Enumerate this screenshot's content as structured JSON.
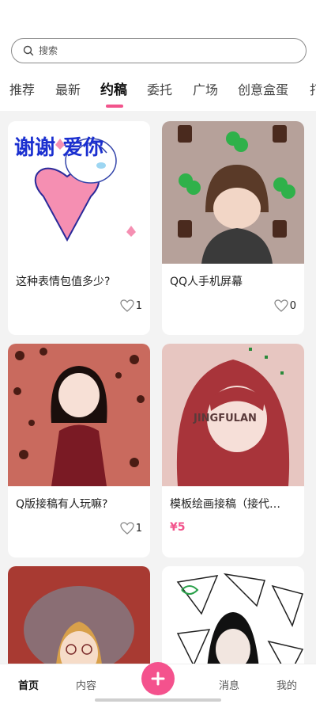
{
  "search": {
    "placeholder": "搜索"
  },
  "tabs": [
    {
      "label": "推荐"
    },
    {
      "label": "最新"
    },
    {
      "label": "约稿"
    },
    {
      "label": "委托"
    },
    {
      "label": "广场"
    },
    {
      "label": "创意盒蛋"
    },
    {
      "label": "打"
    }
  ],
  "active_tab": "约稿",
  "cards": [
    {
      "title": "这种表情包值多少?",
      "likes": "1",
      "image_overlay": "谢谢 爱你"
    },
    {
      "title": "QQ人手机屏幕",
      "likes": "0"
    },
    {
      "title": "Q版接稿有人玩嘛?",
      "likes": "1"
    },
    {
      "title": "模板绘画接稿（接代…",
      "price": "¥5",
      "image_overlay": "JINGFULAN"
    },
    {
      "title": ""
    },
    {
      "title": ""
    }
  ],
  "bottom_nav": {
    "home": "首页",
    "content": "内容",
    "messages": "消息",
    "mine": "我的"
  },
  "colors": {
    "accent": "#f2548c",
    "fab": "#f4528d"
  },
  "icons": [
    "search-icon",
    "heart-icon",
    "plus-icon"
  ]
}
